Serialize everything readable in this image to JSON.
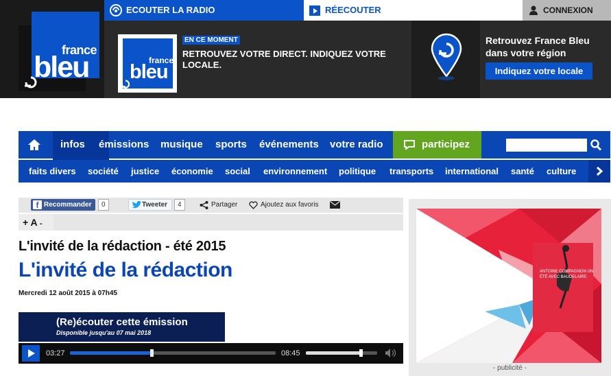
{
  "header": {
    "brand_small": "france",
    "brand_big": "bleu",
    "listen_radio": "ECOUTER LA RADIO",
    "reecouter": "RÉECOUTER",
    "login": "CONNEXION",
    "live_badge": "EN CE MOMENT",
    "live_text": "RETROUVEZ VOTRE DIRECT. INDIQUEZ VOTRE LOCALE.",
    "region_text": "Retrouvez France Bleu dans votre région",
    "region_button": "Indiquez votre locale"
  },
  "main_nav": {
    "items": [
      "infos",
      "émissions",
      "musique",
      "sports",
      "événements",
      "votre radio"
    ],
    "active": "infos",
    "participez": "participez",
    "search": {
      "value": ""
    }
  },
  "sub_nav": {
    "items": [
      "faits divers",
      "société",
      "justice",
      "économie",
      "social",
      "environnement",
      "politique",
      "transports",
      "international",
      "santé",
      "culture"
    ]
  },
  "share": {
    "facebook_label": "Recommander",
    "facebook_count": "0",
    "twitter_label": "Tweeter",
    "twitter_count": "4",
    "share_label": "Partager",
    "favorites_label": "Ajoutez aux favoris",
    "font_plus": "+ A",
    "font_minus": "-"
  },
  "article": {
    "rubrique": "L'invité de la rédaction - été 2015",
    "title": "L'invité de la rédaction",
    "date": "Mercredi 12 août 2015 à 07h45"
  },
  "player": {
    "title": "(Re)écouter cette émission",
    "availability": "Disponible jusqu'au 07 mai 2018",
    "current_time": "03:27",
    "duration": "08:45",
    "progress": 0.395,
    "volume": 0.77
  },
  "advert": {
    "label": "- publicité -",
    "cover_text": "ANTOINE COMPAGNON UN ÉTÉ AVEC BAUDELAIRE"
  },
  "colors": {
    "brand_blue": "#0a53c8",
    "nav_blue": "#0a46b4",
    "participez_green": "#62a51f",
    "ad_red": "#e8213a"
  }
}
